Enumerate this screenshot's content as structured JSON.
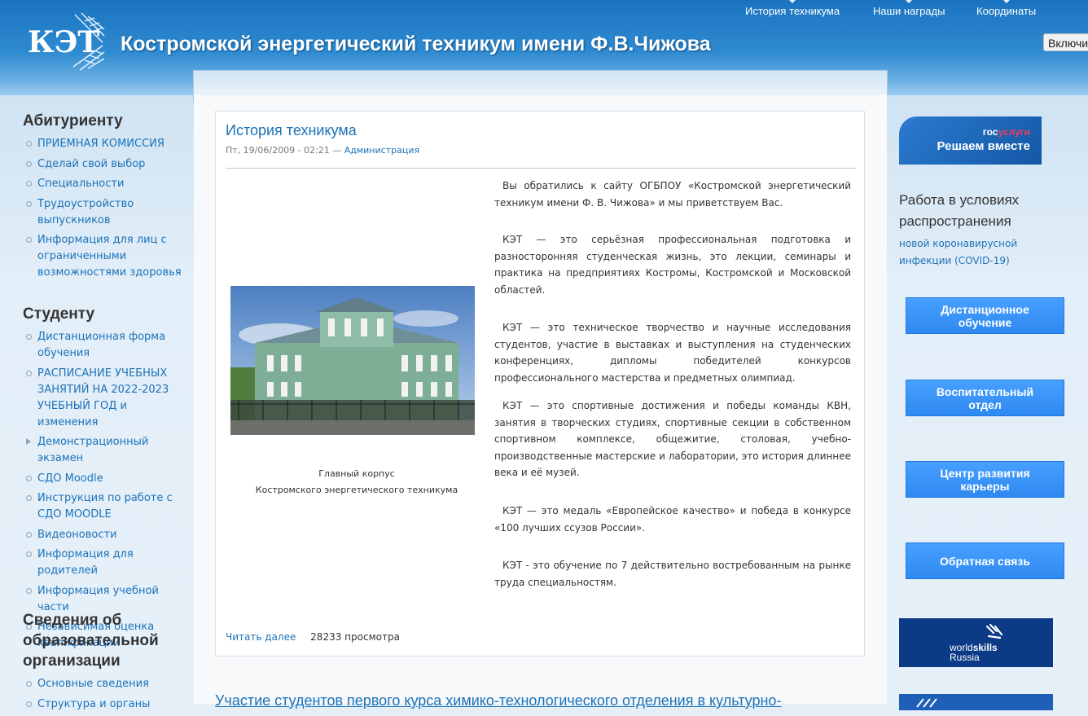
{
  "header": {
    "logo_text": "КЭТ",
    "site_title": "Костромской энергетический техникум имени Ф.В.Чижова",
    "nav": [
      "История техникума",
      "Наши награды",
      "Координаты"
    ],
    "accessibility_label": "Включить"
  },
  "left_sidebar": {
    "abiturient": {
      "title": "Абитуриенту",
      "items": [
        "ПРИЕМНАЯ КОМИССИЯ",
        "Сделай свой выбор",
        "Специальности",
        "Трудоустройство выпускников",
        "Информация для лиц с ограниченными возможностями здоровья"
      ]
    },
    "student": {
      "title": "Студенту",
      "items": [
        "Дистанционная форма обучения",
        "РАСПИСАНИЕ УЧЕБНЫХ ЗАНЯТИЙ НА 2022-2023 УЧЕБНЫЙ ГОД и изменения",
        "Демонстрационный экзамен",
        "СДО Moodle",
        "Инструкция по работе с СДО MOODLE",
        "Видеоновости",
        "Информация для родителей",
        "Информация учебной части",
        "Независимая оценка квалификации"
      ]
    },
    "org_info": {
      "title": "Сведения об образовательной организации",
      "items": [
        "Основные сведения",
        "Структура и органы"
      ]
    }
  },
  "article": {
    "title": "История техникума",
    "meta_date": "Пт, 19/06/2009 - 02:21 — ",
    "meta_author": "Администрация",
    "caption_line1": "Главный корпус",
    "caption_line2": "Костромского энергетического техникума",
    "paragraphs": [
      "Вы обратились к сайту ОГБПОУ «Костромской энергетический техникум имени Ф. В. Чижова» и мы приветствуем Вас.",
      "КЭТ — это серьёзная профессиональная подготовка и разносторонняя студенческая жизнь, это лекции, семинары и практика на предприятиях Костромы, Костромской и Московской областей.",
      "КЭТ — это техническое творчество и научные исследования студентов, участие в выставках и выступления на студенческих конференциях, дипломы победителей конкурсов профессионального мастерства и предметных олимпиад.",
      "КЭТ — это спортивные достижения и победы команды КВН, занятия в творческих студиях, спортивные секции в собственном спортивном комплексе, общежитие, столовая, учебно-производственные мастерские и лаборатории, это история длиннее века и её музей.",
      "КЭТ — это медаль «Европейское качество» и победа в конкурсе «100 лучших ссузов России».",
      "КЭТ - это обучение по 7 действительно востребованным на рынке труда специальностям."
    ],
    "read_more": "Читать далее",
    "views": "28233 просмотра"
  },
  "next_article": {
    "title": "Участие студентов первого курса химико-технологического отделения в культурно-"
  },
  "right_sidebar": {
    "gosuslugi_top_white": "гос",
    "gosuslugi_top_red": "услуги",
    "gosuslugi_main": "Решаем вместе",
    "covid_title": "Работа в условиях распространения",
    "covid_link": "новой коронавирусной инфекции (COVID-19)",
    "buttons": [
      "Дистанционное обучение",
      "Воспитательный отдел",
      "Центр развития карьеры",
      "Обратная связь"
    ],
    "worldskills_thin": "world",
    "worldskills_bold": "skills",
    "worldskills_country": "Russia"
  },
  "colors": {
    "link": "#1c72b8",
    "header_blue": "#2f8bd1",
    "button_blue": "#3a92f6",
    "worldskills_bg": "#0b3a87"
  }
}
